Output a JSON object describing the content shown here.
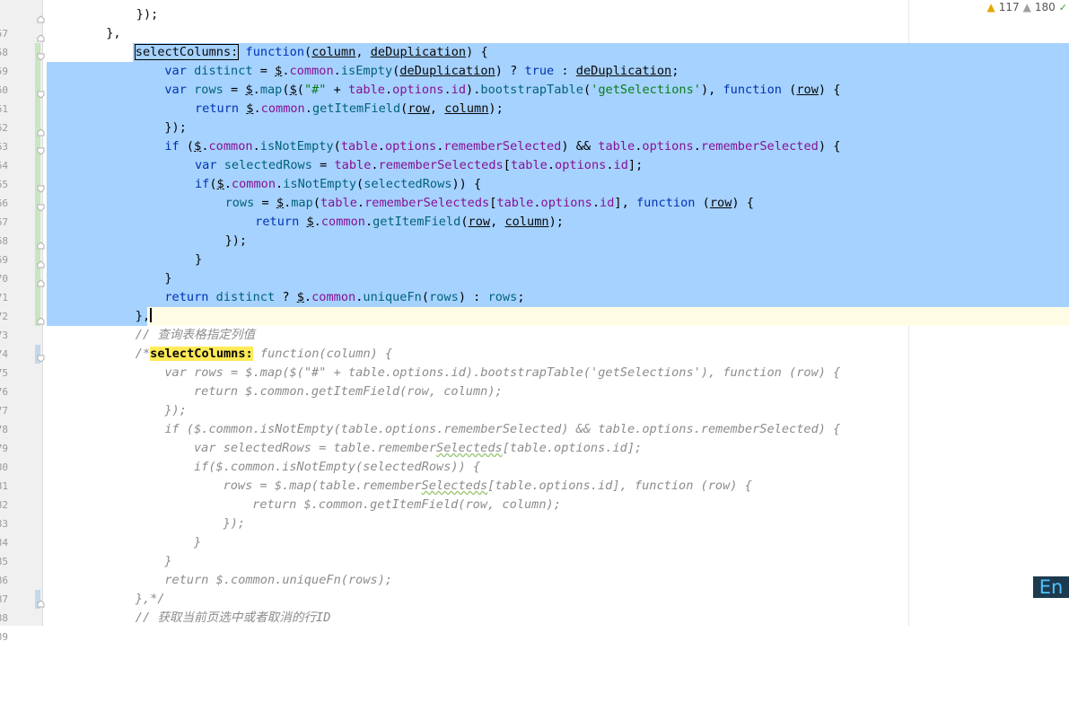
{
  "inspection": {
    "warnings": "117",
    "weak_warnings": "180"
  },
  "ime": {
    "label": "En"
  },
  "gutter": {
    "line_numbers": [
      "57",
      "58",
      "59",
      "60",
      "61",
      "62",
      "63",
      "64",
      "65",
      "66",
      "67",
      "68",
      "69",
      "70",
      "71",
      "72",
      "73",
      "74",
      "75",
      "76",
      "77",
      "78",
      "79",
      "80",
      "81",
      "82",
      "83",
      "84",
      "85",
      "86",
      "87",
      "88",
      "89"
    ]
  },
  "code": {
    "l57": [
      "});"
    ],
    "l58": [
      "},"
    ],
    "l59": [
      "selectColumns:",
      " ",
      "function",
      "(",
      "column",
      ", ",
      "deDuplication",
      ") {"
    ],
    "l60": [
      "var",
      " ",
      "distinct",
      " = ",
      "$",
      ".",
      "common",
      ".",
      "isEmpty",
      "(",
      "deDuplication",
      ") ? ",
      "true",
      " : ",
      "deDuplication",
      ";"
    ],
    "l61": [
      "var",
      " ",
      "rows",
      " = ",
      "$",
      ".",
      "map",
      "(",
      "$",
      "(",
      "\"#\"",
      " + ",
      "table",
      ".",
      "options",
      ".",
      "id",
      ").",
      "bootstrapTable",
      "(",
      "'getSelections'",
      "), ",
      "function",
      " (",
      "row",
      ") {"
    ],
    "l62": [
      "return",
      " ",
      "$",
      ".",
      "common",
      ".",
      "getItemField",
      "(",
      "row",
      ", ",
      "column",
      ");"
    ],
    "l63": [
      "});"
    ],
    "l64": [
      "if",
      " (",
      "$",
      ".",
      "common",
      ".",
      "isNotEmpty",
      "(",
      "table",
      ".",
      "options",
      ".",
      "rememberSelected",
      ") && ",
      "table",
      ".",
      "options",
      ".",
      "rememberSelected",
      ") {"
    ],
    "l65": [
      "var",
      " ",
      "selectedRows",
      " = ",
      "table",
      ".",
      "rememberSelecteds",
      "[",
      "table",
      ".",
      "options",
      ".",
      "id",
      "];"
    ],
    "l66": [
      "if",
      "(",
      "$",
      ".",
      "common",
      ".",
      "isNotEmpty",
      "(",
      "selectedRows",
      ")) {"
    ],
    "l67": [
      "rows",
      " = ",
      "$",
      ".",
      "map",
      "(",
      "table",
      ".",
      "rememberSelecteds",
      "[",
      "table",
      ".",
      "options",
      ".",
      "id",
      "], ",
      "function",
      " (",
      "row",
      ") {"
    ],
    "l68": [
      "return",
      " ",
      "$",
      ".",
      "common",
      ".",
      "getItemField",
      "(",
      "row",
      ", ",
      "column",
      ");"
    ],
    "l69": [
      "});"
    ],
    "l70": [
      "}"
    ],
    "l71": [
      "}"
    ],
    "l72": [
      "return",
      " ",
      "distinct",
      " ? ",
      "$",
      ".",
      "common",
      ".",
      "uniqueFn",
      "(",
      "rows",
      ") : ",
      "rows",
      ";"
    ],
    "l73": [
      "},"
    ],
    "l74": [
      "// 查询表格指定列值"
    ],
    "l75": [
      "/*",
      "selectColumns:",
      " function(column) {"
    ],
    "l76": [
      "var rows = $.map($(\"#\" + table.options.id).bootstrapTable('getSelections'), function (row) {"
    ],
    "l77": [
      "return $.common.getItemField(row, column);"
    ],
    "l78": [
      "});"
    ],
    "l79": [
      "if ($.common.isNotEmpty(table.options.rememberSelected) && table.options.rememberSelected) {"
    ],
    "l80a": "var selectedRows = table.remember",
    "l80b": "Selecteds",
    "l80c": "[table.options.id];",
    "l81": [
      "if($.common.isNotEmpty(selectedRows)) {"
    ],
    "l82a": "rows = $.map(table.remember",
    "l82b": "Selecteds",
    "l82c": "[table.options.id], function (row) {",
    "l83": [
      "return $.common.getItemField(row, column);"
    ],
    "l84": [
      "});"
    ],
    "l85": [
      "}"
    ],
    "l86": [
      "}"
    ],
    "l87": [
      "return $.common.uniqueFn(rows);"
    ],
    "l88": [
      "},*/"
    ],
    "l89": [
      "// 获取当前页选中或者取消的行ID"
    ]
  },
  "colors": {
    "selection": "#a6d2ff",
    "keyword": "#0033b3",
    "function": "#00627a",
    "string": "#067d17",
    "property": "#871094",
    "comment": "#8c8c8c",
    "highlight": "#ffea57"
  }
}
